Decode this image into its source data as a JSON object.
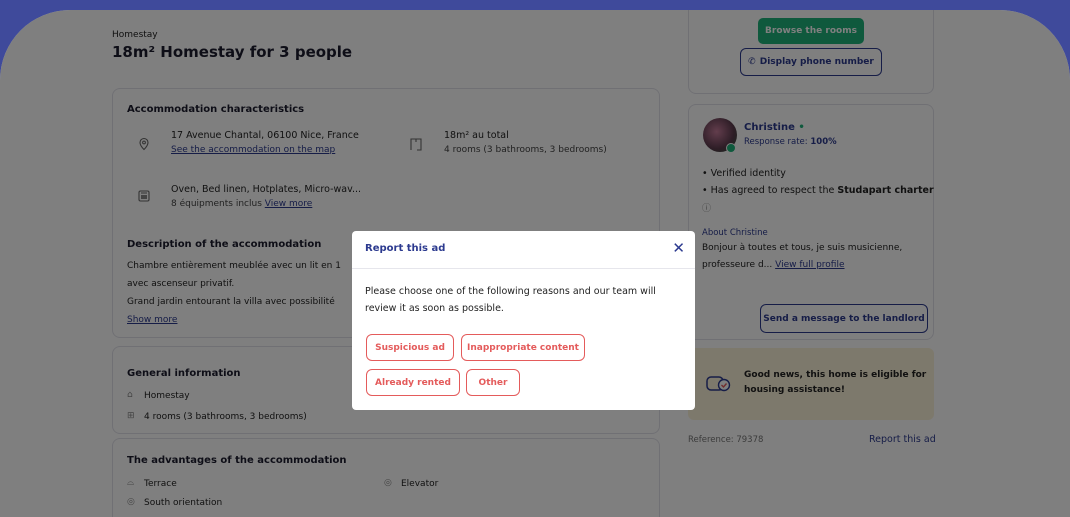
{
  "listing": {
    "category": "Homestay",
    "title": "18m² Homestay for 3 people"
  },
  "characteristics": {
    "heading": "Accommodation characteristics",
    "address": "17 Avenue Chantal, 06100 Nice, France",
    "map_link": "See the accommodation on the map",
    "area": "18m² au total",
    "rooms": "4 rooms (3 bathrooms, 3 bedrooms)",
    "equipment": "Oven, Bed linen, Hotplates, Micro-wav...",
    "equipment_count": "8 équipments inclus",
    "equipment_link": "View more"
  },
  "description": {
    "heading": "Description of the accommodation",
    "line1": "Chambre entièrement meublée avec un lit en 1",
    "line2": "avec ascenseur privatif.",
    "line3": "Grand jardin entourant la villa avec possibilité",
    "show_more": "Show more"
  },
  "general": {
    "heading": "General information",
    "type": "Homestay",
    "rooms": "4 rooms (3 bathrooms, 3 bedrooms)"
  },
  "advantages": {
    "heading": "The advantages of the accommodation",
    "items": [
      "Terrace",
      "Elevator",
      "South orientation"
    ]
  },
  "sidebar": {
    "browse_button": "Browse the rooms",
    "phone_button": "Display phone number",
    "host_name": "Christine",
    "response_rate_label": "Response rate:",
    "response_rate_value": "100%",
    "verified": "Verified identity",
    "charter_prefix": "Has agreed to respect the",
    "charter_name": "Studapart charter",
    "about_heading": "About Christine",
    "about_line1": "Bonjour à toutes et tous, je suis musicienne,",
    "about_line2": "professeure d...",
    "about_link": "View full profile",
    "message_button": "Send a message to the landlord",
    "assist_line1": "Good news, this home is eligible for",
    "assist_line2": "housing assistance!",
    "reference": "Reference: 79378",
    "report_link": "Report this ad"
  },
  "modal": {
    "title": "Report this ad",
    "text": "Please choose one of the following reasons and our team will review it as soon as possible.",
    "reasons": [
      "Suspicious ad",
      "Inappropriate content",
      "Already rented",
      "Other"
    ]
  },
  "colors": {
    "brand_blue": "#2c3a8f",
    "frame_bg": "#3f4a9b",
    "green": "#1fb27a",
    "reason_red": "#e45b5b"
  }
}
